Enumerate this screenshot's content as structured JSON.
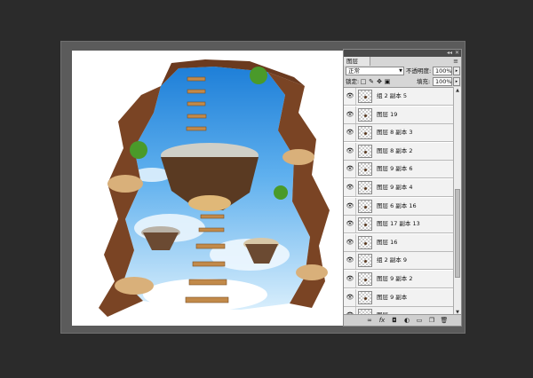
{
  "layers_panel": {
    "tab_label": "图层",
    "blend_mode": "正常",
    "opacity_label": "不透明度:",
    "opacity_value": "100%",
    "lock_label": "锁定:",
    "fill_label": "填充:",
    "fill_value": "100%",
    "layers": [
      {
        "name": "组 2 副本 5",
        "visible": true
      },
      {
        "name": "图层 19",
        "visible": true
      },
      {
        "name": "图层 8 副本 3",
        "visible": true
      },
      {
        "name": "图层 8 副本 2",
        "visible": true
      },
      {
        "name": "图层 9 副本 6",
        "visible": true
      },
      {
        "name": "图层 9 副本 4",
        "visible": true
      },
      {
        "name": "图层 6 副本 16",
        "visible": true
      },
      {
        "name": "图层 17 副本 13",
        "visible": true
      },
      {
        "name": "图层 16",
        "visible": true
      },
      {
        "name": "组 2 副本 9",
        "visible": true
      },
      {
        "name": "图层 9 副本 2",
        "visible": true
      },
      {
        "name": "图层 9 副本",
        "visible": true
      },
      {
        "name": "图层",
        "visible": true
      }
    ],
    "footer_icons": [
      "link-icon",
      "fx-icon",
      "mask-icon",
      "adjustment-icon",
      "folder-icon",
      "new-layer-icon",
      "trash-icon"
    ]
  },
  "colors": {
    "workspace_bg": "#2b2b2b",
    "sky_blue": "#2a8de0",
    "rock_brown": "#6b3a1f",
    "panel_bg": "#d6d6d6"
  }
}
